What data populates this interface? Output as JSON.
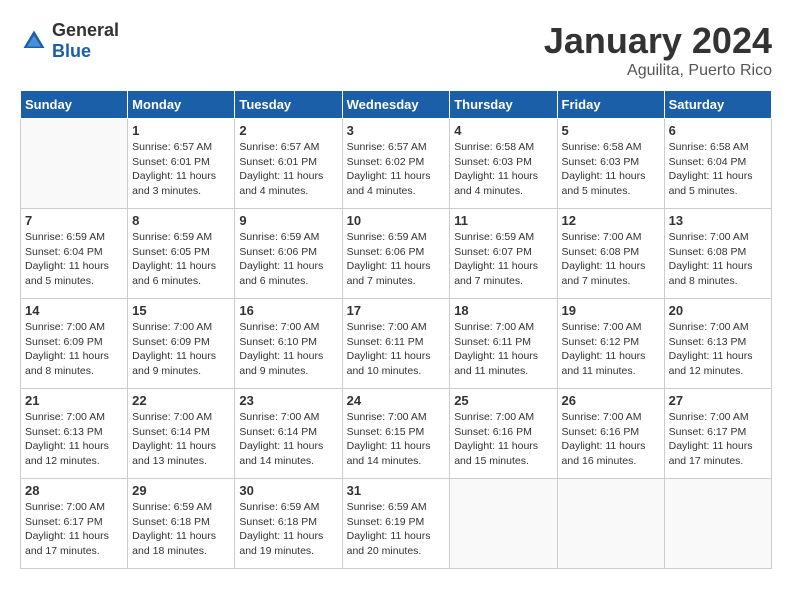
{
  "header": {
    "logo_general": "General",
    "logo_blue": "Blue",
    "month": "January 2024",
    "location": "Aguilita, Puerto Rico"
  },
  "weekdays": [
    "Sunday",
    "Monday",
    "Tuesday",
    "Wednesday",
    "Thursday",
    "Friday",
    "Saturday"
  ],
  "weeks": [
    [
      {
        "day": "",
        "sunrise": "",
        "sunset": "",
        "daylight": ""
      },
      {
        "day": "1",
        "sunrise": "Sunrise: 6:57 AM",
        "sunset": "Sunset: 6:01 PM",
        "daylight": "Daylight: 11 hours and 3 minutes."
      },
      {
        "day": "2",
        "sunrise": "Sunrise: 6:57 AM",
        "sunset": "Sunset: 6:01 PM",
        "daylight": "Daylight: 11 hours and 4 minutes."
      },
      {
        "day": "3",
        "sunrise": "Sunrise: 6:57 AM",
        "sunset": "Sunset: 6:02 PM",
        "daylight": "Daylight: 11 hours and 4 minutes."
      },
      {
        "day": "4",
        "sunrise": "Sunrise: 6:58 AM",
        "sunset": "Sunset: 6:03 PM",
        "daylight": "Daylight: 11 hours and 4 minutes."
      },
      {
        "day": "5",
        "sunrise": "Sunrise: 6:58 AM",
        "sunset": "Sunset: 6:03 PM",
        "daylight": "Daylight: 11 hours and 5 minutes."
      },
      {
        "day": "6",
        "sunrise": "Sunrise: 6:58 AM",
        "sunset": "Sunset: 6:04 PM",
        "daylight": "Daylight: 11 hours and 5 minutes."
      }
    ],
    [
      {
        "day": "7",
        "sunrise": "Sunrise: 6:59 AM",
        "sunset": "Sunset: 6:04 PM",
        "daylight": "Daylight: 11 hours and 5 minutes."
      },
      {
        "day": "8",
        "sunrise": "Sunrise: 6:59 AM",
        "sunset": "Sunset: 6:05 PM",
        "daylight": "Daylight: 11 hours and 6 minutes."
      },
      {
        "day": "9",
        "sunrise": "Sunrise: 6:59 AM",
        "sunset": "Sunset: 6:06 PM",
        "daylight": "Daylight: 11 hours and 6 minutes."
      },
      {
        "day": "10",
        "sunrise": "Sunrise: 6:59 AM",
        "sunset": "Sunset: 6:06 PM",
        "daylight": "Daylight: 11 hours and 7 minutes."
      },
      {
        "day": "11",
        "sunrise": "Sunrise: 6:59 AM",
        "sunset": "Sunset: 6:07 PM",
        "daylight": "Daylight: 11 hours and 7 minutes."
      },
      {
        "day": "12",
        "sunrise": "Sunrise: 7:00 AM",
        "sunset": "Sunset: 6:08 PM",
        "daylight": "Daylight: 11 hours and 7 minutes."
      },
      {
        "day": "13",
        "sunrise": "Sunrise: 7:00 AM",
        "sunset": "Sunset: 6:08 PM",
        "daylight": "Daylight: 11 hours and 8 minutes."
      }
    ],
    [
      {
        "day": "14",
        "sunrise": "Sunrise: 7:00 AM",
        "sunset": "Sunset: 6:09 PM",
        "daylight": "Daylight: 11 hours and 8 minutes."
      },
      {
        "day": "15",
        "sunrise": "Sunrise: 7:00 AM",
        "sunset": "Sunset: 6:09 PM",
        "daylight": "Daylight: 11 hours and 9 minutes."
      },
      {
        "day": "16",
        "sunrise": "Sunrise: 7:00 AM",
        "sunset": "Sunset: 6:10 PM",
        "daylight": "Daylight: 11 hours and 9 minutes."
      },
      {
        "day": "17",
        "sunrise": "Sunrise: 7:00 AM",
        "sunset": "Sunset: 6:11 PM",
        "daylight": "Daylight: 11 hours and 10 minutes."
      },
      {
        "day": "18",
        "sunrise": "Sunrise: 7:00 AM",
        "sunset": "Sunset: 6:11 PM",
        "daylight": "Daylight: 11 hours and 11 minutes."
      },
      {
        "day": "19",
        "sunrise": "Sunrise: 7:00 AM",
        "sunset": "Sunset: 6:12 PM",
        "daylight": "Daylight: 11 hours and 11 minutes."
      },
      {
        "day": "20",
        "sunrise": "Sunrise: 7:00 AM",
        "sunset": "Sunset: 6:13 PM",
        "daylight": "Daylight: 11 hours and 12 minutes."
      }
    ],
    [
      {
        "day": "21",
        "sunrise": "Sunrise: 7:00 AM",
        "sunset": "Sunset: 6:13 PM",
        "daylight": "Daylight: 11 hours and 12 minutes."
      },
      {
        "day": "22",
        "sunrise": "Sunrise: 7:00 AM",
        "sunset": "Sunset: 6:14 PM",
        "daylight": "Daylight: 11 hours and 13 minutes."
      },
      {
        "day": "23",
        "sunrise": "Sunrise: 7:00 AM",
        "sunset": "Sunset: 6:14 PM",
        "daylight": "Daylight: 11 hours and 14 minutes."
      },
      {
        "day": "24",
        "sunrise": "Sunrise: 7:00 AM",
        "sunset": "Sunset: 6:15 PM",
        "daylight": "Daylight: 11 hours and 14 minutes."
      },
      {
        "day": "25",
        "sunrise": "Sunrise: 7:00 AM",
        "sunset": "Sunset: 6:16 PM",
        "daylight": "Daylight: 11 hours and 15 minutes."
      },
      {
        "day": "26",
        "sunrise": "Sunrise: 7:00 AM",
        "sunset": "Sunset: 6:16 PM",
        "daylight": "Daylight: 11 hours and 16 minutes."
      },
      {
        "day": "27",
        "sunrise": "Sunrise: 7:00 AM",
        "sunset": "Sunset: 6:17 PM",
        "daylight": "Daylight: 11 hours and 17 minutes."
      }
    ],
    [
      {
        "day": "28",
        "sunrise": "Sunrise: 7:00 AM",
        "sunset": "Sunset: 6:17 PM",
        "daylight": "Daylight: 11 hours and 17 minutes."
      },
      {
        "day": "29",
        "sunrise": "Sunrise: 6:59 AM",
        "sunset": "Sunset: 6:18 PM",
        "daylight": "Daylight: 11 hours and 18 minutes."
      },
      {
        "day": "30",
        "sunrise": "Sunrise: 6:59 AM",
        "sunset": "Sunset: 6:18 PM",
        "daylight": "Daylight: 11 hours and 19 minutes."
      },
      {
        "day": "31",
        "sunrise": "Sunrise: 6:59 AM",
        "sunset": "Sunset: 6:19 PM",
        "daylight": "Daylight: 11 hours and 20 minutes."
      },
      {
        "day": "",
        "sunrise": "",
        "sunset": "",
        "daylight": ""
      },
      {
        "day": "",
        "sunrise": "",
        "sunset": "",
        "daylight": ""
      },
      {
        "day": "",
        "sunrise": "",
        "sunset": "",
        "daylight": ""
      }
    ]
  ]
}
